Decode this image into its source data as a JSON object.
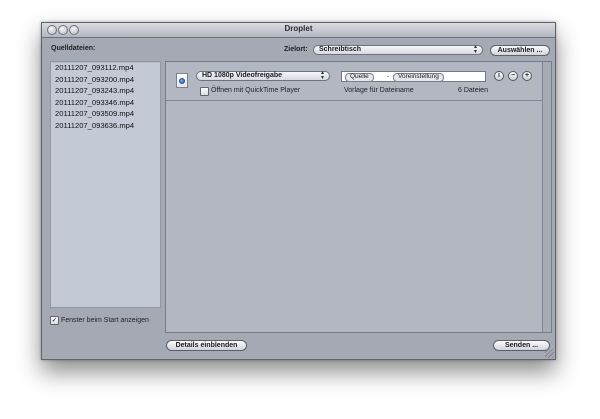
{
  "window": {
    "title": "Droplet"
  },
  "source_panel": {
    "label": "Quelldateien:",
    "files": [
      "20111207_093112.mp4",
      "20111207_093200.mp4",
      "20111207_093243.mp4",
      "20111207_093346.mp4",
      "20111207_093509.mp4",
      "20111207_093636.mp4"
    ]
  },
  "destination": {
    "label": "Zielort:",
    "value": "Schreibtisch",
    "choose_button": "Auswählen ..."
  },
  "preset": {
    "name": "HD 1080p Videofreigabe",
    "open_with_label": "Öffnen mit QuickTime Player",
    "open_with_checked": false,
    "tokens": [
      "Quelle",
      "Voreinstellung"
    ],
    "token_separator": "-",
    "filename_template_label": "Vorlage für Dateiname",
    "file_count": "6 Dateien",
    "info_symbol": "i",
    "remove_symbol": "−",
    "add_symbol": "+"
  },
  "footer": {
    "show_on_start_label": "Fenster beim Start anzeigen",
    "show_on_start_checked": true,
    "details_button": "Details einblenden",
    "send_button": "Senden ...",
    "check_symbol": "✓"
  },
  "colors": {
    "selection": "#c4c9d6",
    "window_bg": "#a5a9b3",
    "panel_bg": "#b2b7c2"
  }
}
